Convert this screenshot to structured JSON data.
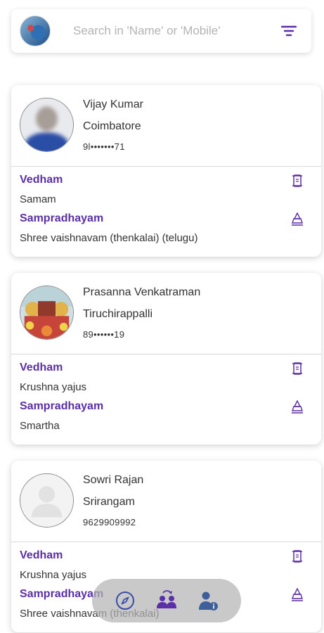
{
  "search": {
    "placeholder": "Search in 'Name' or 'Mobile'",
    "avatar_icon": "profile-photo",
    "filter_icon": "filter-icon"
  },
  "labels": {
    "vedham": "Vedham",
    "sampradhayam": "Sampradhayam"
  },
  "profiles": [
    {
      "name": "Vijay Kumar",
      "city": "Coimbatore",
      "phone": "9l•••••••71",
      "vedham": "Samam",
      "sampradhayam": "Shree vaishnavam (thenkalai) (telugu)",
      "avatar": "blurred-photo"
    },
    {
      "name": "Prasanna Venkatraman",
      "city": "Tiruchirappalli",
      "phone": "89••••••19",
      "vedham": "Krushna yajus",
      "sampradhayam": "Smartha",
      "avatar": "colorful-photo"
    },
    {
      "name": "Sowri Rajan",
      "city": "Srirangam",
      "phone": "9629909992",
      "vedham": "Krushna yajus",
      "sampradhayam": "Shree vaishnavam (thenkalai)",
      "avatar": "default-avatar"
    }
  ],
  "colors": {
    "accent": "#5b2fa6",
    "nav_background": "#b4b4b4"
  },
  "bottom_nav": {
    "items": [
      "compass-icon",
      "people-swap-icon",
      "person-info-icon"
    ]
  }
}
